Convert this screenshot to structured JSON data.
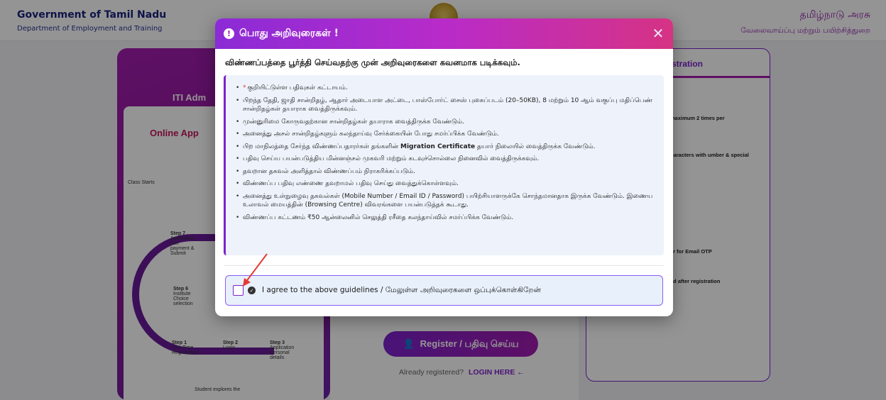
{
  "header": {
    "gov_title": "Government of Tamil Nadu",
    "dept_title": "Department of Employment and Training",
    "gov_title_ta": "தமிழ்நாடு அரசு",
    "dept_title_ta": "வேலைவாய்ப்பு மற்றும் பயிற்சித்துறை"
  },
  "left_card": {
    "title": "ITI Adm",
    "online": "Online App",
    "steps": [
      {
        "label": "Step 7",
        "text": "Application Fee payment & Submit"
      },
      {
        "label": "Step 6",
        "text": "Institute Choice selection"
      },
      {
        "label": "Step 1",
        "text": "One Time Registration"
      },
      {
        "label": "Step 2",
        "text": "Login"
      },
      {
        "label": "Step 3",
        "text": "Application Personal details"
      }
    ],
    "class_starts": "Class Starts",
    "student_explores": "Student explores the"
  },
  "center": {
    "register_label": "Register / பதிவு செய்ய",
    "already_text": "Already registered?",
    "login_label": "LOGIN HERE ←"
  },
  "right_card": {
    "title": "stration",
    "notes": [
      "maximum 2 times per",
      "haracters with umber & special",
      "er for Email OTP",
      "ed after registration"
    ]
  },
  "modal": {
    "title": "பொது அறிவுரைகள் !",
    "close_symbol": "✕",
    "subtitle": "விண்ணப்பத்தை பூர்த்தி செய்வதற்கு முன் அறிவுரைகளை கவனமாக படிக்கவும்.",
    "guidelines": [
      {
        "req": "*",
        "text": "குறியிட்டுள்ள பதிவுகள் கட்டாயம்."
      },
      {
        "text": "பிறந்த தேதி, ஜாதி சான்றிதழ், ஆதார் அடையாள அட்டை, பாஸ்போர்ட் சைஸ் புகைப்படம் (20–50KB), 8 மற்றும் 10 ஆம் வகுப்பு மதிப்பெண் சான்றிதழ்கள் தயாராக வைத்திருக்கவும்."
      },
      {
        "text": "முன்னுரிமை கோருவதற்கான சான்றிதழ்கள் தயாராக வைத்திருக்க வேண்டும்."
      },
      {
        "text": "அனைத்து அசல் சான்றிதழ்களும் கலந்தாய்வு சேர்க்கையின் போது சமர்ப்பிக்க வேண்டும்."
      },
      {
        "pre": "பிற மாநிலத்தை சேர்ந்த விண்ணப்பதாரர்கள் தங்களின் ",
        "bold": "Migration Certificate",
        "post": " தயார் நிலையில் வைத்திருக்க வேண்டும்."
      },
      {
        "text": "பதிவு செய்ய பயன்படுத்திய மின்னஞ்சல் முகவரி மற்றும் கடவுச்சொல்லை நினைவில் வைத்திருக்கவும்."
      },
      {
        "text": "தவறான தகவல் அளித்தால் விண்ணப்பம் நிராகரிக்கப்படும்."
      },
      {
        "text": "விண்ணப்ப பதிவு எண்ணை தவறாமல் பதிவு செய்து வைத்துக்கொள்ளவும்."
      },
      {
        "text": "அனைத்து உள்நுழைவு தகவல்கள் (Mobile Number / Email ID / Password) பயிற்சியாளருக்கே சொந்தமானதாக இருக்க வேண்டும். இணைய உலாவல் மையத்தின் (Browsing Centre) விவரங்களை பயன்படுத்தக் கூடாது."
      },
      {
        "text": "விண்ணப்ப கட்டணம் ₹50 ஆன்லைனில் செலுத்தி ரசீதை கலந்தாய்வில் சமர்ப்பிக்க வேண்டும்."
      }
    ],
    "agree_label": "I agree to the above guidelines / மேலுள்ள அறிவுரைகளை ஒப்புக்கொள்கிறேன்",
    "agree_checked": false
  }
}
